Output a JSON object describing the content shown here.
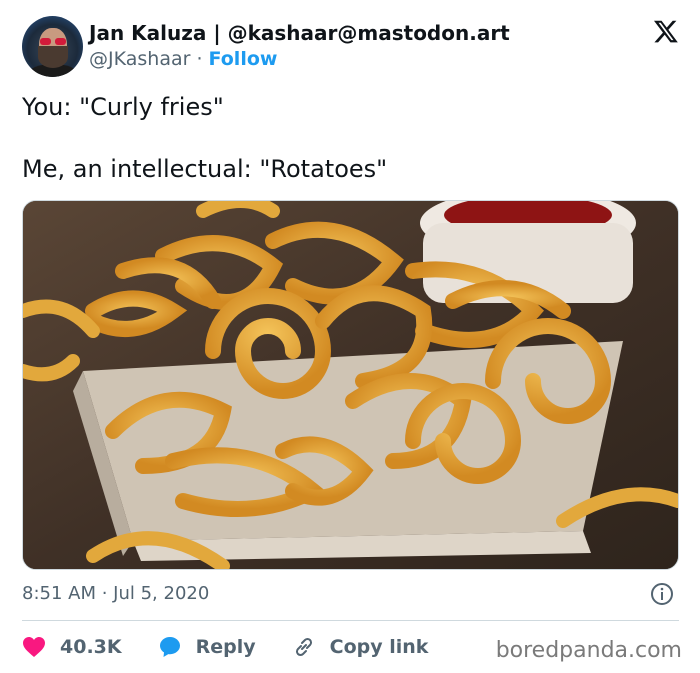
{
  "author": {
    "display_name": "Jan Kaluza | @kashaar@mastodon.art",
    "handle": "@JKashaar",
    "separator": " · ",
    "follow_label": "Follow"
  },
  "tweet": {
    "line1": "You: \"Curly fries\"",
    "line2": "Me, an intellectual: \"Rotatoes\""
  },
  "media": {
    "description_icon": "photo-curly-fries"
  },
  "meta": {
    "timestamp": "8:51 AM · Jul 5, 2020"
  },
  "actions": {
    "likes": "40.3K",
    "reply_label": "Reply",
    "copy_link_label": "Copy link"
  },
  "watermark": "boredpanda.com",
  "colors": {
    "accent": "#1d9bf0",
    "like": "#f91880",
    "text": "#0f1419",
    "muted": "#536471"
  }
}
